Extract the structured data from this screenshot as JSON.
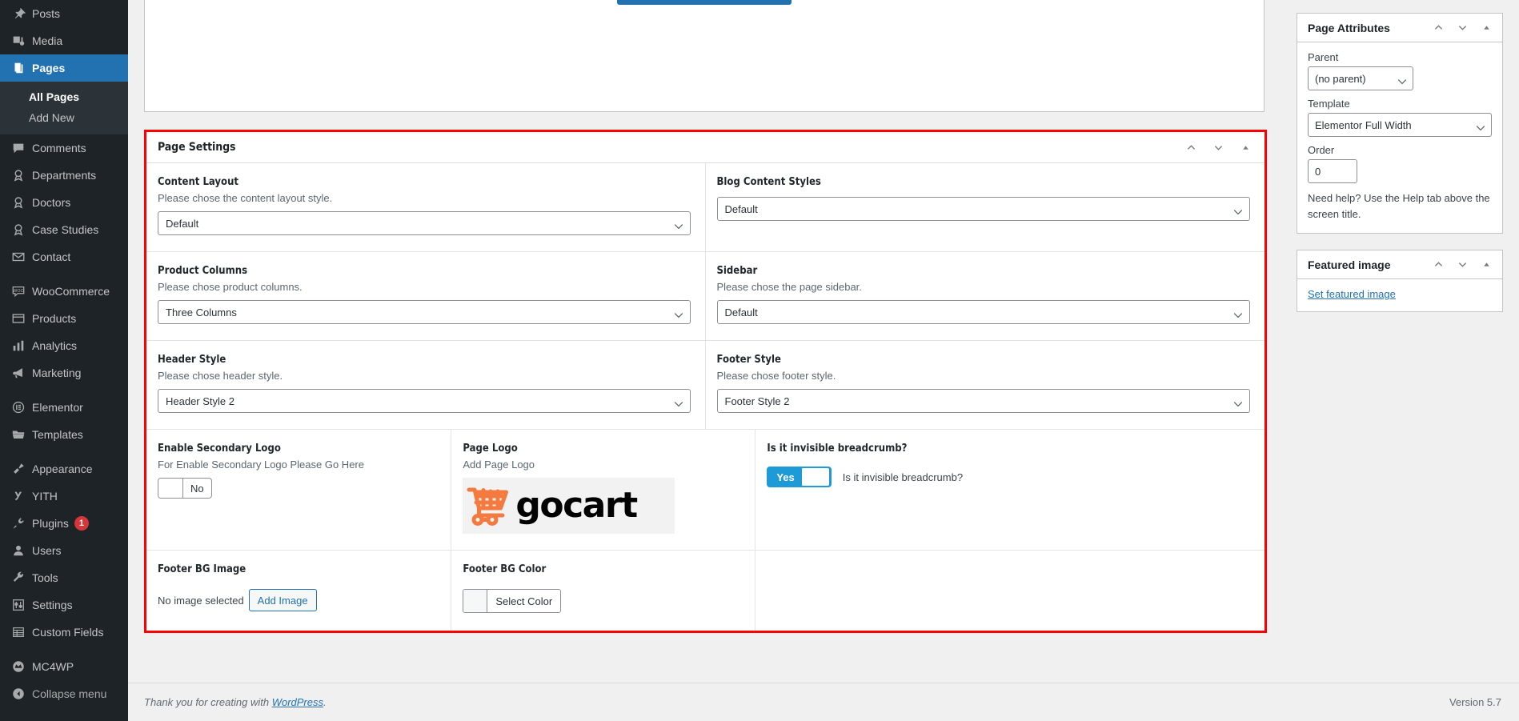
{
  "sidebar": {
    "items": [
      {
        "label": "Posts",
        "icon": "pin-icon",
        "current": false
      },
      {
        "label": "Media",
        "icon": "media-icon",
        "current": false
      },
      {
        "label": "Pages",
        "icon": "pages-icon",
        "current": true
      }
    ],
    "submenu": [
      {
        "label": "All Pages",
        "active": true
      },
      {
        "label": "Add New",
        "active": false
      }
    ],
    "items2": [
      {
        "label": "Comments",
        "icon": "comment-icon"
      },
      {
        "label": "Departments",
        "icon": "award-icon"
      },
      {
        "label": "Doctors",
        "icon": "award-icon"
      },
      {
        "label": "Case Studies",
        "icon": "award-icon"
      },
      {
        "label": "Contact",
        "icon": "envelope-icon"
      }
    ],
    "items3": [
      {
        "label": "WooCommerce",
        "icon": "woo-icon"
      },
      {
        "label": "Products",
        "icon": "products-icon"
      },
      {
        "label": "Analytics",
        "icon": "chart-icon"
      },
      {
        "label": "Marketing",
        "icon": "megaphone-icon"
      }
    ],
    "items4": [
      {
        "label": "Elementor",
        "icon": "elementor-icon"
      },
      {
        "label": "Templates",
        "icon": "folder-icon"
      }
    ],
    "items5": [
      {
        "label": "Appearance",
        "icon": "brush-icon"
      },
      {
        "label": "YITH",
        "icon": "yith-icon"
      },
      {
        "label": "Plugins",
        "icon": "plug-icon",
        "badge": "1"
      },
      {
        "label": "Users",
        "icon": "user-icon"
      },
      {
        "label": "Tools",
        "icon": "wrench-icon"
      },
      {
        "label": "Settings",
        "icon": "sliders-icon"
      },
      {
        "label": "Custom Fields",
        "icon": "table-icon"
      }
    ],
    "items6": [
      {
        "label": "MC4WP",
        "icon": "mc4wp-icon"
      }
    ],
    "collapse": {
      "label": "Collapse menu",
      "icon": "collapse-arrow-icon"
    }
  },
  "page_settings": {
    "title": "Page Settings",
    "controls": {
      "up": "chevron-up-icon",
      "down": "chevron-down-icon",
      "toggle": "caret-up-icon"
    },
    "highlight_color": "#ff0000",
    "fields": {
      "content_layout": {
        "label": "Content Layout",
        "desc": "Please chose the content layout style.",
        "value": "Default"
      },
      "blog_content_styles": {
        "label": "Blog Content Styles",
        "desc": "",
        "value": "Default"
      },
      "product_columns": {
        "label": "Product Columns",
        "desc": "Please chose product columns.",
        "value": "Three Columns"
      },
      "sidebar": {
        "label": "Sidebar",
        "desc": "Please chose the page sidebar.",
        "value": "Default"
      },
      "header_style": {
        "label": "Header Style",
        "desc": "Please chose header style.",
        "value": "Header Style 2"
      },
      "footer_style": {
        "label": "Footer Style",
        "desc": "Please chose footer style.",
        "value": "Footer Style 2"
      },
      "enable_secondary_logo": {
        "label": "Enable Secondary Logo",
        "desc": "For Enable Secondary Logo Please Go Here",
        "toggle_state": "No"
      },
      "page_logo": {
        "label": "Page Logo",
        "desc": "Add Page Logo",
        "logo_text": "gocart",
        "logo_icon": "shopping-cart-icon",
        "logo_accent": "#f47b3f"
      },
      "invisible_breadcrumb": {
        "label": "Is it invisible breadcrumb?",
        "toggle_state": "Yes",
        "after_text": "Is it invisible breadcrumb?",
        "toggle_color": "#1e9ad6"
      },
      "footer_bg_image": {
        "label": "Footer BG Image",
        "status": "No image selected",
        "button": "Add Image"
      },
      "footer_bg_color": {
        "label": "Footer BG Color",
        "button": "Select Color"
      }
    }
  },
  "page_attributes": {
    "title": "Page Attributes",
    "parent_label": "Parent",
    "parent_value": "(no parent)",
    "template_label": "Template",
    "template_value": "Elementor Full Width",
    "order_label": "Order",
    "order_value": "0",
    "help": "Need help? Use the Help tab above the screen title."
  },
  "featured_image": {
    "title": "Featured image",
    "link": "Set featured image"
  },
  "footer": {
    "thanks_prefix": "Thank you for creating with ",
    "thanks_link": "WordPress",
    "thanks_suffix": ".",
    "version": "Version 5.7"
  }
}
